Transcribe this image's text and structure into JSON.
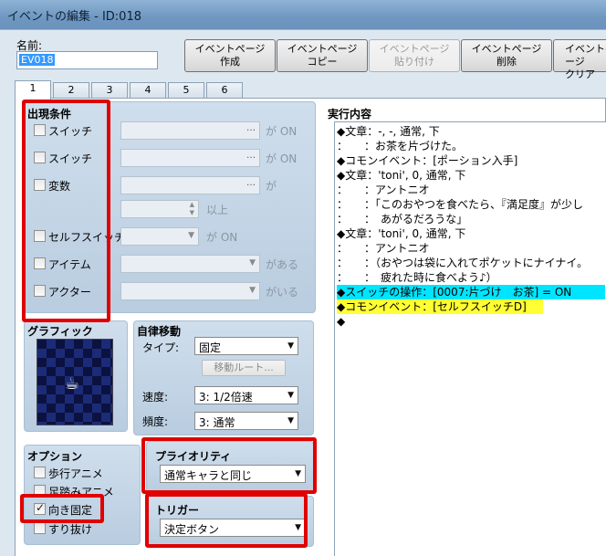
{
  "window": {
    "title": "イベントの編集 - ID:018"
  },
  "name_field": {
    "label": "名前:",
    "value": "EV018"
  },
  "toolbar": {
    "create_page": "イベントページ\n作成",
    "copy_page": "イベントページ\nコピー",
    "paste_page": "イベントページ\n貼り付け",
    "delete_page": "イベントページ\n削除",
    "clear_page": "イベントページ\nクリア"
  },
  "tabs": [
    "1",
    "2",
    "3",
    "4",
    "5",
    "6"
  ],
  "conditions": {
    "title": "出現条件",
    "switch1": {
      "label": "スイッチ",
      "suffix": "が ON"
    },
    "switch2": {
      "label": "スイッチ",
      "suffix": "が ON"
    },
    "variable": {
      "label": "変数",
      "suffix": "が",
      "suffix2": "以上"
    },
    "self_switch": {
      "label": "セルフスイッチ",
      "suffix": "が ON"
    },
    "item": {
      "label": "アイテム",
      "suffix": "がある"
    },
    "actor": {
      "label": "アクター",
      "suffix": "がいる"
    }
  },
  "graphic": {
    "title": "グラフィック"
  },
  "autonomous": {
    "title": "自律移動",
    "type_label": "タイプ:",
    "type_value": "固定",
    "route_button": "移動ルート...",
    "speed_label": "速度:",
    "speed_value": "3: 1/2倍速",
    "freq_label": "頻度:",
    "freq_value": "3: 通常"
  },
  "options": {
    "title": "オプション",
    "walking_anim": "歩行アニメ",
    "stepping_anim": "足踏みアニメ",
    "direction_fix": "向き固定",
    "through": "すり抜け"
  },
  "priority": {
    "title": "プライオリティ",
    "value": "通常キャラと同じ"
  },
  "trigger": {
    "title": "トリガー",
    "value": "決定ボタン"
  },
  "contents": {
    "title": "実行内容",
    "lines": [
      "◆文章：-, -, 通常, 下",
      "：　　：お茶を片づけた。",
      "◆コモンイベント：[ポーション入手]",
      "◆文章：'toni', 0, 通常, 下",
      "：　　：アントニオ",
      "：　　：「このおやつを食べたら、『満足度』が少し",
      "：　　：　あがるだろうな」",
      "◆文章：'toni', 0, 通常, 下",
      "：　　：アントニオ",
      "：　　：（おやつは袋に入れてポケットにナイナイ。",
      "：　　：　疲れた時に食べよう♪）",
      "◆スイッチの操作：[0007:片づけ　お茶] = ON",
      "◆コモンイベント：[セルフスイッチD]",
      "◆"
    ]
  },
  "colors": {
    "highlight_red": "#e00000",
    "cyan_line": "#00e5ff",
    "yellow_line": "#ffff33"
  }
}
